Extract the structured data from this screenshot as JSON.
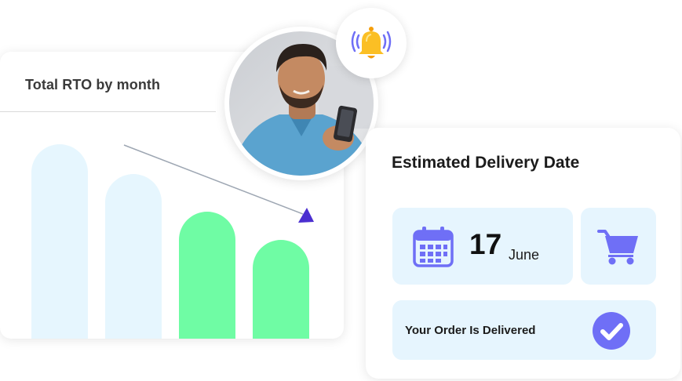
{
  "rto_card": {
    "title": "Total RTO by month"
  },
  "chart_data": {
    "type": "bar",
    "title": "Total RTO by month",
    "categories": [],
    "series": [
      {
        "values": [
          248,
          210,
          162,
          126
        ],
        "colors": [
          "#e6f6fe",
          "#e6f6fe",
          "#6ffca4",
          "#6ffca4"
        ]
      }
    ],
    "trend": "decreasing",
    "ylim": [
      0,
      260
    ],
    "grid": false
  },
  "avatar": {
    "icon": "user-photo"
  },
  "notification": {
    "icon": "bell-icon",
    "color": "#fbbf24"
  },
  "delivery": {
    "title": "Estimated Delivery Date",
    "day": "17",
    "month": "June",
    "calendar_icon": "calendar-icon",
    "cart_icon": "cart-icon",
    "status": "Your Order Is Delivered",
    "status_icon": "check-circle-icon",
    "accent_color": "#6f6ff6",
    "tile_color": "#e6f5fe"
  }
}
